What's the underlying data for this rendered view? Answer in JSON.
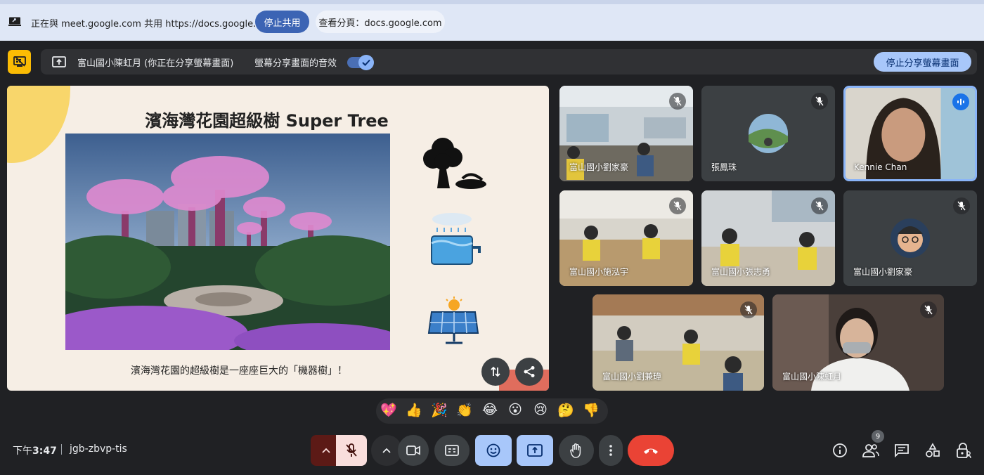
{
  "chrome_share": {
    "text": "正在與 meet.google.com 共用 https://docs.google.com",
    "stop_share": "停止共用",
    "view_tab": "查看分頁：docs.google.com"
  },
  "present_bar": {
    "presenter": "富山國小陳虹月 (你正在分享螢幕畫面)",
    "audio_label": "螢幕分享畫面的音效",
    "audio_on": true,
    "stop_present": "停止分享螢幕畫面"
  },
  "slide": {
    "title": "濱海灣花園超級樹 Super Tree",
    "caption": "濱海灣花園的超級樹是一座座巨大的「機器樹」！"
  },
  "tiles": [
    {
      "name": "富山國小劉家豪",
      "muted": true
    },
    {
      "name": "張鳳珠",
      "muted": true
    },
    {
      "name": "Kennie Chan",
      "muted": false,
      "speaking": true
    },
    {
      "name": "富山國小施泓宇",
      "muted": true
    },
    {
      "name": "富山國小張志勇",
      "muted": true
    },
    {
      "name": "富山國小劉家豪",
      "muted": true
    },
    {
      "name": "富山國小劉兼瑋",
      "muted": true
    },
    {
      "name": "富山國小陳虹月",
      "muted": true
    }
  ],
  "reactions": [
    "💖",
    "👍",
    "🎉",
    "👏",
    "😂",
    "😮",
    "😢",
    "🤔",
    "👎"
  ],
  "bottom": {
    "time_prefix": "下午",
    "time": "3:47",
    "meeting_code": "jgb-zbvp-tis",
    "people_count": "9"
  },
  "colors": {
    "background": "#202124",
    "accent": "#a8c7fa",
    "leave": "#ea4335",
    "present_indicator": "#fbbc04"
  }
}
